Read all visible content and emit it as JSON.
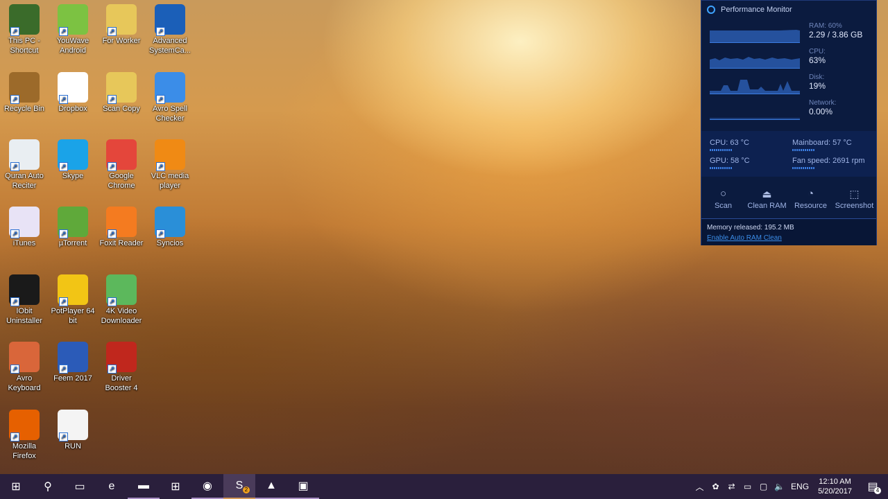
{
  "desktop": {
    "icons": [
      {
        "label": "This PC - Shortcut",
        "icon": "this-pc-icon",
        "color": "#3a6b2a"
      },
      {
        "label": "YouWave Android",
        "icon": "android-icon",
        "color": "#7cc242"
      },
      {
        "label": "For Worker",
        "icon": "folder-icon",
        "color": "#e7c75a"
      },
      {
        "label": "Advanced SystemCa...",
        "icon": "advanced-systemcare-icon",
        "color": "#1b5fb8"
      },
      {
        "label": "Recycle Bin",
        "icon": "recycle-bin-icon",
        "color": "#9c6a2a"
      },
      {
        "label": "Dropbox",
        "icon": "dropbox-icon",
        "color": "#ffffff"
      },
      {
        "label": "Scan Copy",
        "icon": "folder-icon",
        "color": "#e7c75a"
      },
      {
        "label": "Avro Spell Checker",
        "icon": "checkmark-icon",
        "color": "#3b8de8"
      },
      {
        "label": "Quran Auto Reciter",
        "icon": "mosque-icon",
        "color": "#e9eef2"
      },
      {
        "label": "Skype",
        "icon": "skype-icon",
        "color": "#1aa3e8"
      },
      {
        "label": "Google Chrome",
        "icon": "chrome-icon",
        "color": "#e4463b"
      },
      {
        "label": "VLC media player",
        "icon": "vlc-icon",
        "color": "#f08a14"
      },
      {
        "label": "iTunes",
        "icon": "itunes-icon",
        "color": "#e8e3f6"
      },
      {
        "label": "µTorrent",
        "icon": "utorrent-icon",
        "color": "#5fa93a"
      },
      {
        "label": "Foxit Reader",
        "icon": "foxit-pdf-icon",
        "color": "#f47b20"
      },
      {
        "label": "Syncios",
        "icon": "syncios-icon",
        "color": "#2a8fd8"
      },
      {
        "label": "IObit Uninstaller",
        "icon": "iobit-uninstaller-icon",
        "color": "#1a1a1a"
      },
      {
        "label": "PotPlayer 64 bit",
        "icon": "potplayer-icon",
        "color": "#f2c515"
      },
      {
        "label": "4K Video Downloader",
        "icon": "cloud-download-icon",
        "color": "#5cb85c"
      },
      {
        "label": "Avro Keyboard",
        "icon": "avro-keyboard-icon",
        "color": "#d9663a"
      },
      {
        "label": "Feem 2017",
        "icon": "feem-icon",
        "color": "#2b5bb8"
      },
      {
        "label": "Driver Booster 4",
        "icon": "driver-booster-icon",
        "color": "#c0271d"
      },
      {
        "label": "Mozilla Firefox",
        "icon": "firefox-icon",
        "color": "#e66000"
      },
      {
        "label": "RUN",
        "icon": "windows-xp-icon",
        "color": "#f4f4f4"
      }
    ]
  },
  "performance_monitor": {
    "title": "Performance Monitor",
    "ram": {
      "label": "RAM: 60%",
      "value": "2.29 / 3.86 GB",
      "percent": 60
    },
    "cpu": {
      "label": "CPU:",
      "value": "63%",
      "percent": 63
    },
    "disk": {
      "label": "Disk:",
      "value": "19%",
      "percent": 19
    },
    "network": {
      "label": "Network:",
      "value": "0.00%",
      "percent": 0
    },
    "sensors": {
      "cpu_temp": "CPU:  63 °C",
      "gpu_temp": "GPU:  58 °C",
      "mainboard": "Mainboard:  57 °C",
      "fan_speed": "Fan speed:  2691 rpm"
    },
    "buttons": {
      "scan": "Scan",
      "clean_ram": "Clean RAM",
      "resource": "Resource",
      "screenshot": "Screenshot"
    },
    "memory_released": "Memory released: 195.2 MB",
    "auto_clean_link": "Enable Auto RAM Clean"
  },
  "taskbar": {
    "apps": [
      {
        "icon": "windows-start-icon"
      },
      {
        "icon": "search-icon"
      },
      {
        "icon": "task-view-icon"
      },
      {
        "icon": "edge-icon"
      },
      {
        "icon": "file-explorer-icon"
      },
      {
        "icon": "store-icon"
      },
      {
        "icon": "chrome-icon"
      },
      {
        "icon": "skype-icon",
        "badge": "2"
      },
      {
        "icon": "vlc-icon"
      },
      {
        "icon": "syncios-icon"
      }
    ],
    "language": "ENG",
    "time": "12:10 AM",
    "date": "5/20/2017",
    "notification_count": "4"
  }
}
